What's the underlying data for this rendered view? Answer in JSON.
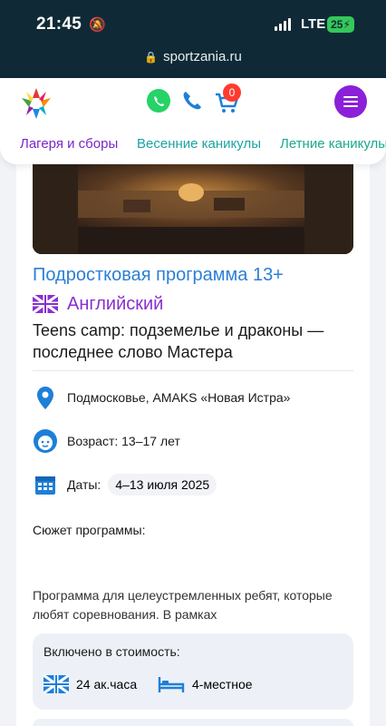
{
  "status_bar": {
    "time": "21:45",
    "network": "LTE",
    "battery": "25",
    "url": "sportzania.ru"
  },
  "header": {
    "cart_count": "0",
    "nav": [
      "Лагеря и сборы",
      "Весенние каникулы",
      "Летние каникулы"
    ]
  },
  "program": {
    "title": "Подростковая программа 13+",
    "language": "Английский",
    "subtitle": "Teens camp: подземелье и драконы — последнее слово Мастера",
    "location": "Подмосковье, AMAKS «Новая Истра»",
    "age": "Возраст: 13–17 лет",
    "dates_label": "Даты:",
    "dates_value": "4–13 июля 2025",
    "plot_heading": "Сюжет программы:",
    "plot_text": "Программа для целеустремленных ребят, которые любят соревнования. В рамках",
    "included_heading": "Включено в стоимость:",
    "included_items": [
      "24 ак.часа",
      "4-местное"
    ]
  },
  "colors": {
    "statusbar_bg": "#0f2a36",
    "accent_purple": "#8a20d8",
    "title_blue": "#2b7fd6"
  }
}
